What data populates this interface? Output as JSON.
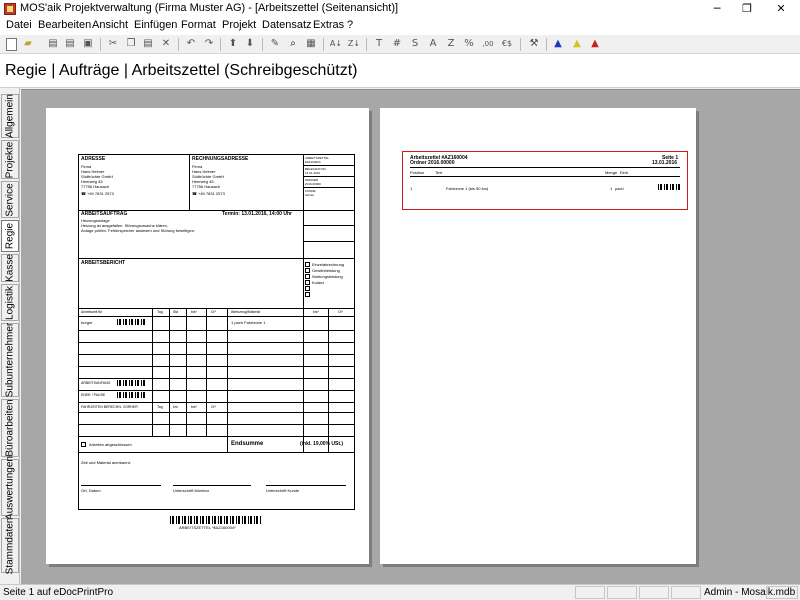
{
  "window": {
    "title": "MOS'aik Projektverwaltung (Firma Muster AG) - [Arbeitszettel (Seitenansicht)]",
    "minimize": "─",
    "maximize": "❐",
    "close": "✕"
  },
  "menu": [
    "Datei",
    "Bearbeiten",
    "Ansicht",
    "Einfügen",
    "Format",
    "Projekt",
    "Datensatz",
    "Extras",
    "?"
  ],
  "toolbar": {
    "letters": [
      "T",
      "#",
      "S",
      "A",
      "Z",
      "%"
    ],
    "icons": [
      "new-icon",
      "open-icon",
      "print-icon",
      "print-setup-icon",
      "print-preview-icon",
      "cut-icon",
      "copy-icon",
      "paste-icon",
      "delete-icon",
      "undo-icon",
      "redo-icon",
      "up-arrow-icon",
      "down-arrow-icon",
      "edit-icon",
      "search-icon",
      "properties-icon",
      "sort-az-icon",
      "sort-za-icon",
      "text-icon",
      "number-icon",
      "sum-icon",
      "average-icon",
      "count-icon",
      "percent-icon",
      "decimal-icon",
      "currency-icon",
      "tools-icon",
      "user-blue-icon",
      "user-yellow-icon",
      "user-red-icon"
    ]
  },
  "header": {
    "title": "Regie | Aufträge | Arbeitszettel (Schreibgeschützt)"
  },
  "sidebar": {
    "tabs": [
      "Allgemein",
      "Projekte",
      "Service",
      "Regie",
      "Kasse",
      "Logistik",
      "Subunternehmer",
      "Büroarbeiten",
      "Auswertungen",
      "Stammdaten"
    ],
    "active": "Regie"
  },
  "page1": {
    "addr_label": "ADRESSE",
    "addr_lines": [
      "Firma",
      "Hans Helmer",
      "Südfrüchte GmbH",
      "Heerweg 45",
      "77756 Hausach"
    ],
    "phone": "+49 7831 2573",
    "billing_label": "RECHNUNGSADRESSE",
    "billing_lines": [
      "Firma",
      "Hans Helmer",
      "Südfrüchte GmbH",
      "Heerweg 45",
      "77756 Hausach"
    ],
    "billing_phone": "+49 7831 2573",
    "info": [
      "ARBEITSZETTEL",
      "#AZ160004",
      "BELEGDATUM",
      "13.01.2016",
      "ORDNER",
      "2016.00000",
      "KUNDE",
      "helmer"
    ],
    "job_label": "ARBEITSAUFTRAG",
    "appointment": "Termin: 13.01.2016, 14:00 Uhr",
    "job_lines": [
      "Heizungsanlage",
      "Heizung ist ausgefallen. Störungsursache klären.",
      "Anlage prüfen, Fehlerspeicher auslesen und Störung beseitigen."
    ],
    "report_label": "ARBEITSBERICHT",
    "checkboxes": [
      "Einzelabrechnung",
      "Gewährleistung",
      "Wartungsleistung",
      "Kulanz"
    ],
    "table_left": {
      "headers": [
        "Arbeitszeit für",
        "Tag",
        "Std",
        "bis*",
        "Ct*"
      ],
      "first_row": "burger"
    },
    "table_right": {
      "headers": [
        "Werkzeug/Material",
        "bis*",
        "Ct*"
      ],
      "first_row": "1 pach Fahrtzone 1"
    },
    "labels": [
      "ARBEITSANFANG",
      "ENDE / PAUSE",
      "FAHRZEITEN BERECHN. VORHER"
    ],
    "trip_headers": [
      "Tag",
      "km",
      "bis*",
      "Ct*"
    ],
    "done_label": "Arbeiten abgeschlossen",
    "total_label": "Endsumme",
    "total_vat": "(inkl. 19,00% USt.)",
    "confirm": "Zeit und Material anerkannt:",
    "sign": [
      "Ort, Datum",
      "Unterschrift Monteur",
      "Unterschrift Kunde"
    ],
    "footer_barcode_text": "ARBEITSZETTEL *$AZ160004*"
  },
  "page2": {
    "title": "Arbeitszettel #AZ160004",
    "folder": "Ordner 2016.00000",
    "page": "Seite 1",
    "date": "13.01.2016",
    "headers": [
      "Position",
      "Text",
      "Menge",
      "Einh"
    ],
    "row": {
      "pos": "1",
      "text": "Fahrtzone 1 (bis 50 km)",
      "qty": "1",
      "unit": "pach"
    }
  },
  "status": {
    "left": "Seite 1 auf eDocPrintPro",
    "user": "Admin - Mosaik.mdb"
  }
}
